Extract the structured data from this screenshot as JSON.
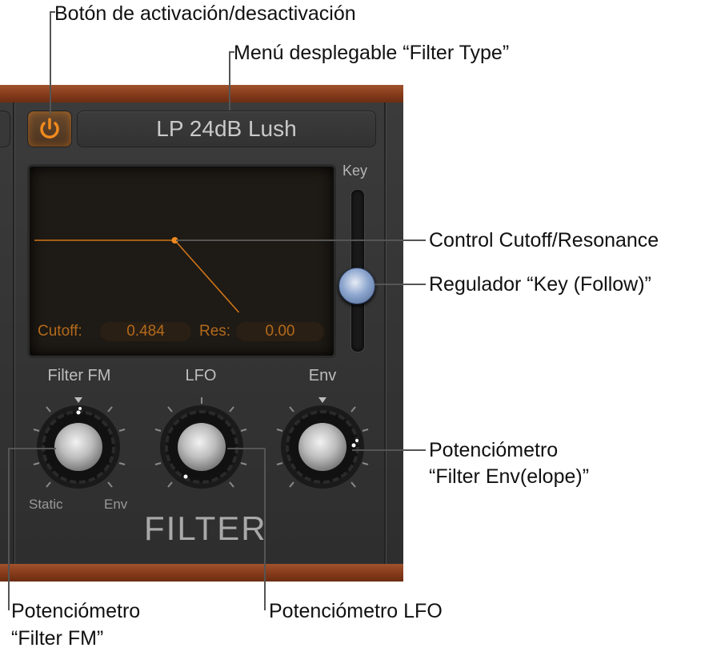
{
  "callouts": {
    "power_button": "Botón de activación/desactivación",
    "filter_type_menu": "Menú desplegable “Filter Type”",
    "cutoff_resonance": "Control Cutoff/Resonance",
    "key_follow": "Regulador “Key (Follow)”",
    "filter_env_line1": "Potenciómetro",
    "filter_env_line2": "“Filter Env(elope)”",
    "filter_fm_line1": "Potenciómetro",
    "filter_fm_line2": "“Filter FM”",
    "lfo": "Potenciómetro LFO"
  },
  "filter": {
    "type_value": "LP 24dB Lush",
    "key_label": "Key",
    "cutoff_label": "Cutoff:",
    "cutoff_value": "0.484",
    "res_label": "Res:",
    "res_value": "0.00",
    "cutoff": 0.484,
    "resonance": 0.0,
    "key_follow": 0.5,
    "knobs": {
      "filter_fm": "Filter FM",
      "lfo": "LFO",
      "env": "Env"
    },
    "fm_min_label": "Static",
    "fm_max_label": "Env",
    "section_title": "FILTER"
  },
  "colors": {
    "accent": "#e07b1a",
    "panel": "#353535",
    "wood": "#8a3e1c",
    "display_bg": "#1e1a15"
  }
}
